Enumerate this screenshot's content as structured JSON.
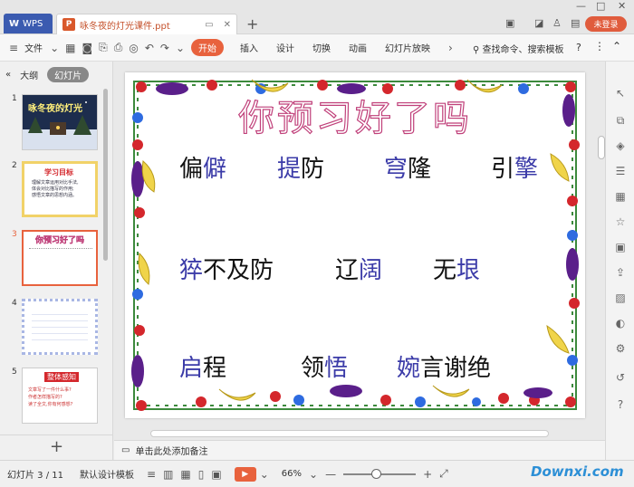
{
  "titlebar": {
    "app_tab_label": "WPS",
    "doc_tab_title": "咏冬夜的灯光课件.ppt",
    "login_label": "未登录",
    "icons": [
      "close-icon",
      "add-tab-icon",
      "minimize-icon",
      "maximize-icon",
      "skin-icon",
      "user-icon"
    ]
  },
  "ribbon": {
    "file_label": "文件",
    "start_label": "开始",
    "tabs": [
      "插入",
      "设计",
      "切换",
      "动画",
      "幻灯片放映"
    ],
    "search_label": "查找命令、搜索模板",
    "help_label": "?"
  },
  "leftpanel": {
    "outline_label": "大纲",
    "slides_label": "幻灯片",
    "add_label": "+",
    "thumbs": [
      {
        "num": "1",
        "title": "咏冬夜的灯光"
      },
      {
        "num": "2",
        "title": "学习目标",
        "lines": [
          "理解文章运用对比手法,",
          "体会对比描写的作用;",
          "感悟文章的思想内涵。"
        ]
      },
      {
        "num": "3",
        "title": "你预习好了吗"
      },
      {
        "num": "4",
        "title": ""
      },
      {
        "num": "5",
        "title": "整体感知",
        "lines": [
          "文章写了一件什么事?",
          "作者怎样描写的?",
          "读了全文,你有何感想?"
        ]
      }
    ]
  },
  "slide": {
    "title": "你预习好了吗",
    "rows": [
      [
        {
          "a": "偏",
          "b": "僻"
        },
        {
          "a": "",
          "b": "提",
          "c": "防"
        },
        {
          "a": "",
          "b": "穹",
          "c": "隆"
        },
        {
          "a": "引",
          "b": "擎"
        }
      ],
      [
        {
          "b": "猝",
          "c": "不及防"
        },
        {
          "a": "辽",
          "b": "阔"
        },
        {
          "a": "无",
          "b": "垠"
        }
      ],
      [
        {
          "b": "启",
          "c": "程"
        },
        {
          "a": "领",
          "b": "悟"
        },
        {
          "b": "婉",
          "c": "言谢绝"
        }
      ]
    ]
  },
  "notes": {
    "placeholder": "单击此处添加备注"
  },
  "status": {
    "slide_counter": "幻灯片 3 / 11",
    "template_label": "默认设计模板",
    "zoom": "66%",
    "zoom_fraction": 0.45
  },
  "watermark": "Downxi.com",
  "colors": {
    "accent": "#e8623d",
    "title_outline": "#c0407a",
    "highlight": "#3b3ba8"
  }
}
